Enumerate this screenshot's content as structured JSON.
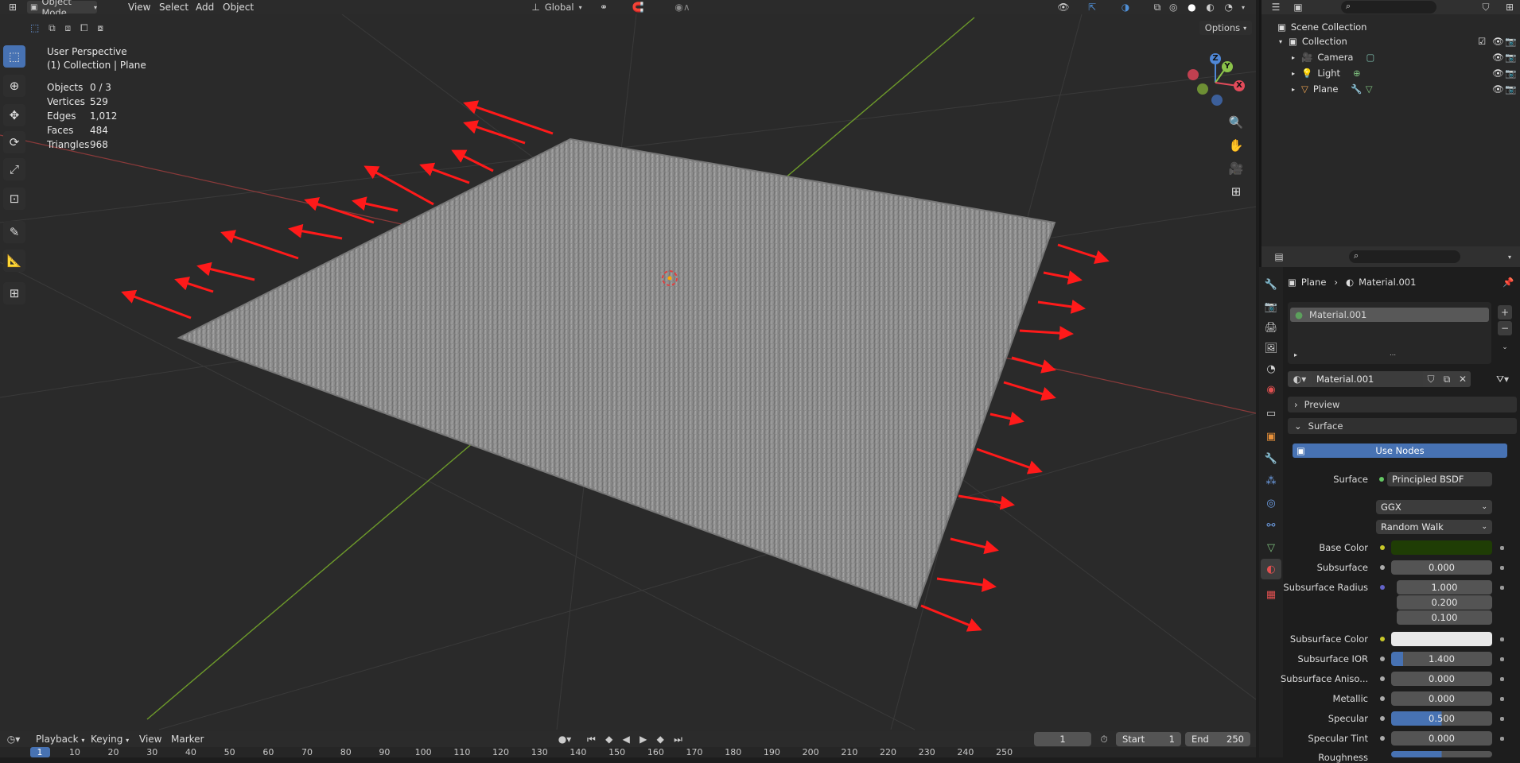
{
  "header": {
    "mode": "Object Mode",
    "menus": [
      "View",
      "Select",
      "Add",
      "Object"
    ],
    "transform_orientation": "Global",
    "options": "Options"
  },
  "viewport": {
    "perspective": "User Perspective",
    "collection": "(1) Collection | Plane",
    "stats": [
      {
        "label": "Objects",
        "value": "0 / 3"
      },
      {
        "label": "Vertices",
        "value": "529"
      },
      {
        "label": "Edges",
        "value": "1,012"
      },
      {
        "label": "Faces",
        "value": "484"
      },
      {
        "label": "Triangles",
        "value": "968"
      }
    ],
    "gizmo": {
      "x": "X",
      "y": "Y",
      "z": "Z"
    }
  },
  "outliner": {
    "root": "Scene Collection",
    "collection": "Collection",
    "items": [
      "Camera",
      "Light",
      "Plane"
    ]
  },
  "properties": {
    "breadcrumb_object": "Plane",
    "breadcrumb_material": "Material.001",
    "slot": "Material.001",
    "material_name": "Material.001",
    "panels": {
      "preview": "Preview",
      "surface": "Surface"
    },
    "use_nodes": "Use Nodes",
    "surface_label": "Surface",
    "surface_value": "Principled BSDF",
    "distribution": "GGX",
    "subsurface_method": "Random Walk",
    "rows": [
      {
        "label": "Base Color",
        "value": ""
      },
      {
        "label": "Subsurface",
        "value": "0.000"
      },
      {
        "label": "Subsurface Radius",
        "value": "1.000"
      },
      {
        "label": "",
        "value": "0.200"
      },
      {
        "label": "",
        "value": "0.100"
      },
      {
        "label": "Subsurface Color",
        "value": ""
      },
      {
        "label": "Subsurface IOR",
        "value": "1.400"
      },
      {
        "label": "Subsurface Aniso...",
        "value": "0.000"
      },
      {
        "label": "Metallic",
        "value": "0.000"
      },
      {
        "label": "Specular",
        "value": "0.500"
      },
      {
        "label": "Specular Tint",
        "value": "0.000"
      },
      {
        "label": "Roughness",
        "value": "0.500"
      }
    ],
    "colors": {
      "base_color": "#1f3d05",
      "subsurface_color": "#e8e8e8",
      "accent": "#4772b3"
    }
  },
  "timeline": {
    "menus": [
      "Playback",
      "Keying",
      "View",
      "Marker"
    ],
    "current_frame": "1",
    "start_label": "Start",
    "start": "1",
    "end_label": "End",
    "end": "250",
    "ticks": [
      "1",
      "10",
      "20",
      "30",
      "40",
      "50",
      "60",
      "70",
      "80",
      "90",
      "100",
      "110",
      "120",
      "130",
      "140",
      "150",
      "160",
      "170",
      "180",
      "190",
      "200",
      "210",
      "220",
      "230",
      "240",
      "250"
    ]
  }
}
